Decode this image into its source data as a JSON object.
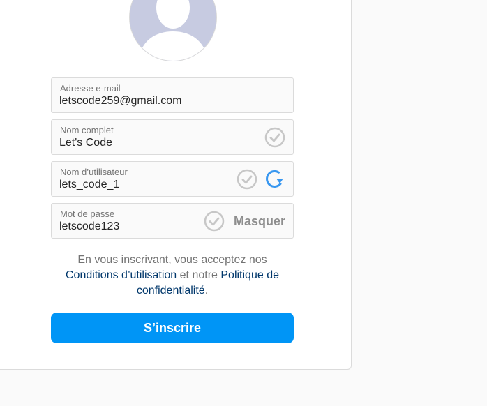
{
  "form": {
    "email": {
      "label": "Adresse e-mail",
      "value": "letscode259@gmail.com"
    },
    "fullname": {
      "label": "Nom complet",
      "value": "Let's Code"
    },
    "username": {
      "label": "Nom d’utilisateur",
      "value": "lets_code_1"
    },
    "password": {
      "label": "Mot de passe",
      "value": "letscode123",
      "toggle_label": "Masquer"
    }
  },
  "terms": {
    "prefix": "En vous inscrivant, vous acceptez nos",
    "terms_link": "Conditions d’utilisation",
    "middle": "et notre",
    "privacy_link": "Politique de confidentialité",
    "suffix": "."
  },
  "submit_label": "S’inscrire",
  "icons": {
    "avatar": "default-avatar-silhouette",
    "valid": "check-circle-icon",
    "refresh": "refresh-icon"
  },
  "colors": {
    "accent": "#0095f6",
    "link": "#00376b",
    "avatar_bg": "#c7cbe1",
    "check": "#c7c7c7",
    "refresh": "#3897f0"
  }
}
